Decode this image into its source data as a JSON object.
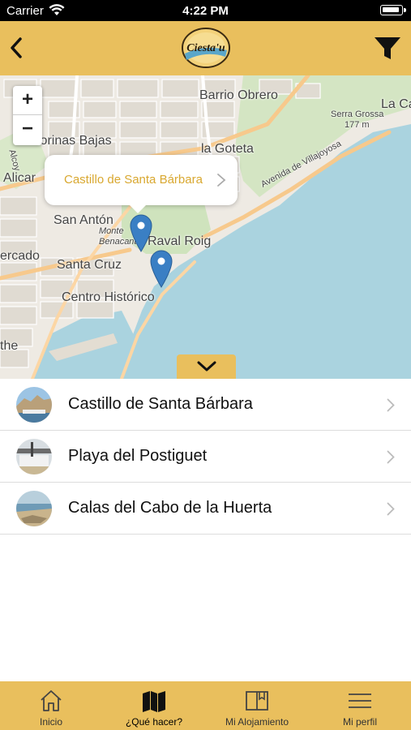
{
  "status_bar": {
    "carrier": "Carrier",
    "time": "4:22 PM"
  },
  "navbar": {
    "logo_text": "Ciesta'u",
    "back_icon": "chevron-left-icon",
    "filter_icon": "filter-icon"
  },
  "map": {
    "labels": {
      "barrio_obrero": "Barrio Obrero",
      "la_ca": "La Ca",
      "serra_grossa": "Serra Grossa",
      "elevation": "177 m",
      "florinas_bajas": "lorinas Bajas",
      "la_goteta": "la Goteta",
      "alicante": "Alicar",
      "avenida": "Avenida de Villajoyosa",
      "san_anton": "San Antón",
      "monte_benacantil": "Monte Benacantil",
      "raval_roig": "Raval Roig",
      "mercado": "ercado",
      "santa_cruz": "Santa Cruz",
      "centro_historico": "Centro Histórico",
      "the": "the",
      "alcoy": "Alcoy"
    },
    "zoom_in": "+",
    "zoom_out": "−",
    "popup_title": "Castillo de Santa Bárbara",
    "accent_color": "#e9bf5d",
    "sea_color": "#aad3df",
    "pin_color": "#3a7fc4"
  },
  "places": [
    {
      "name": "Castillo de Santa Bárbara"
    },
    {
      "name": "Playa del Postiguet"
    },
    {
      "name": "Calas del Cabo de la Huerta"
    }
  ],
  "tabs": [
    {
      "label": "Inicio",
      "icon": "home-icon"
    },
    {
      "label": "¿Qué hacer?",
      "icon": "map-icon",
      "active": true
    },
    {
      "label": "Mi Alojamiento",
      "icon": "book-icon"
    },
    {
      "label": "Mi perfil",
      "icon": "menu-icon"
    }
  ]
}
